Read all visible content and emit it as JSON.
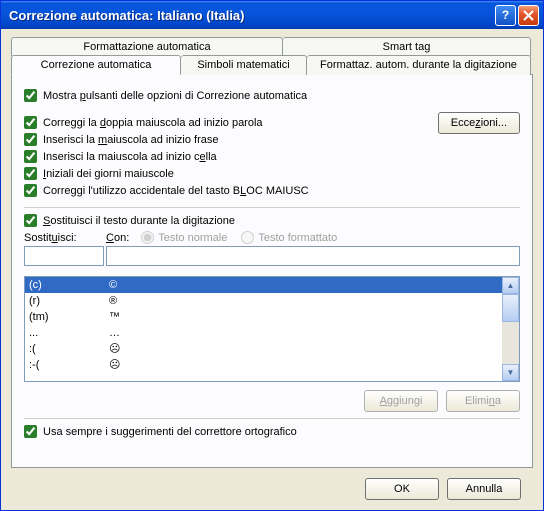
{
  "title": "Correzione automatica: Italiano (Italia)",
  "tabs_top": [
    "Formattazione automatica",
    "Smart tag"
  ],
  "tabs_bottom": [
    "Correzione automatica",
    "Simboli matematici",
    "Formattaz. autom. durante la digitazione"
  ],
  "checks": {
    "mostra": "Mostra pulsanti delle opzioni di Correzione automatica",
    "doppia": "Correggi la doppia maiuscola ad inizio parola",
    "inizio_frase": "Inserisci la maiuscola ad inizio frase",
    "inizio_cella": "Inserisci la maiuscola ad inizio cella",
    "giorni": "Iniziali dei giorni maiuscole",
    "bloc": "Correggi l'utilizzo accidentale del tasto BLOC MAIUSC",
    "sostituisci": "Sostituisci il testo durante la digitazione",
    "suggerimenti": "Usa sempre i suggerimenti del correttore ortografico"
  },
  "labels": {
    "sostituisci": "Sostituisci:",
    "con": "Con:",
    "testo_normale": "Testo normale",
    "testo_formattato": "Testo formattato",
    "eccezioni": "Eccezioni...",
    "aggiungi": "Aggiungi",
    "elimina": "Elimina",
    "ok": "OK",
    "annulla": "Annulla"
  },
  "list": [
    {
      "k": "(c)",
      "v": "©"
    },
    {
      "k": "(r)",
      "v": "®"
    },
    {
      "k": "(tm)",
      "v": "™"
    },
    {
      "k": "...",
      "v": "…"
    },
    {
      "k": ":(",
      "v": "☹"
    },
    {
      "k": ":-(",
      "v": "☹"
    }
  ]
}
